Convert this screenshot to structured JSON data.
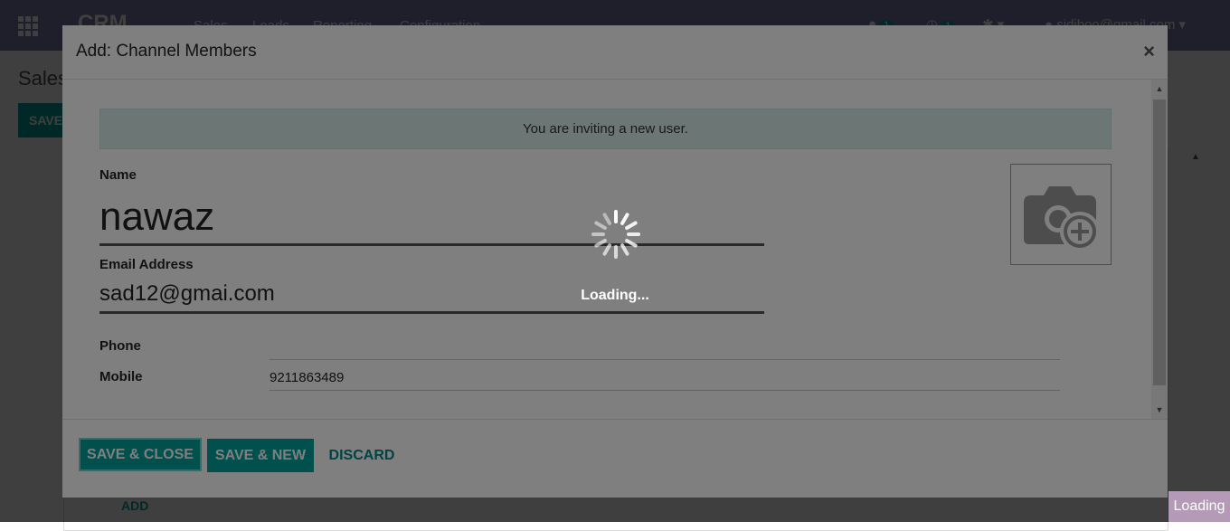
{
  "navbar": {
    "brand": "CRM",
    "menu": [
      "Sales",
      "Leads",
      "Reporting",
      "Configuration"
    ],
    "messages_count": "1",
    "activities_count": "1",
    "user_email": "sidiboo@gmail.com"
  },
  "background": {
    "page_title": "Sales",
    "save_label": "SAVE",
    "add_line_label": "ADD"
  },
  "dialog": {
    "title": "Add: Channel Members",
    "close_symbol": "×",
    "info_message": "You are inviting a new user.",
    "name_label": "Name",
    "name_value": "nawaz",
    "email_label": "Email Address",
    "email_value": "sad12@gmai.com",
    "phone_label": "Phone",
    "phone_value": "",
    "mobile_label": "Mobile",
    "mobile_value": "9211863489",
    "avatar_icon": "camera-plus-icon"
  },
  "footer": {
    "save_close": "SAVE & CLOSE",
    "save_new": "SAVE & NEW",
    "discard": "DISCARD"
  },
  "loading": {
    "text": "Loading...",
    "badge": "Loading"
  },
  "colors": {
    "primary": "#00a09d",
    "navbar": "#7c7bad",
    "info_bg": "#d8ede9",
    "loading_badge": "#b49ab7"
  }
}
